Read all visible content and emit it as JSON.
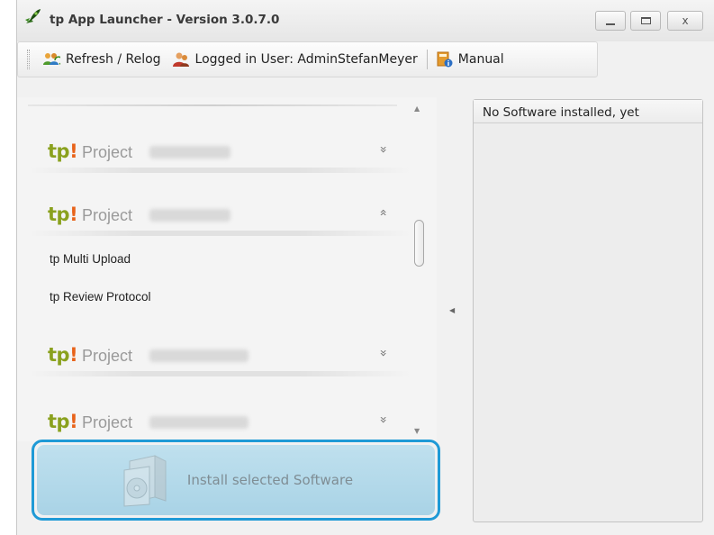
{
  "window": {
    "title": "tp App Launcher - Version 3.0.7.0",
    "controls": {
      "minimize": "minimize",
      "maximize": "maximize",
      "close": "x"
    }
  },
  "toolbar": {
    "refresh_label": "Refresh / Relog",
    "user_label": "Logged in User: AdminStefanMeyer",
    "manual_label": "Manual"
  },
  "projects": {
    "items": [
      {
        "logo_t": "tp",
        "logo_ex": "!",
        "label": "Project",
        "expanded": false,
        "chevron": "»"
      },
      {
        "logo_t": "tp",
        "logo_ex": "!",
        "label": "Project",
        "expanded": true,
        "chevron": "«",
        "children": [
          "tp Multi Upload",
          "tp Review Protocol"
        ]
      },
      {
        "logo_t": "tp",
        "logo_ex": "!",
        "label": "Project",
        "expanded": false,
        "chevron": "»"
      },
      {
        "logo_t": "tp",
        "logo_ex": "!",
        "label": "Project",
        "expanded": false,
        "chevron": "»"
      }
    ]
  },
  "right_panel": {
    "header": "No Software installed, yet"
  },
  "install_button": {
    "label": "Install selected Software"
  },
  "colors": {
    "accent_border": "#1f9ad6",
    "install_bg": "#b5daeb",
    "logo_green": "#8aa11e",
    "logo_orange": "#e8631a"
  },
  "icons": {
    "app": "rocket-icon",
    "refresh": "users-refresh-icon",
    "user": "user-icon",
    "manual": "book-info-icon",
    "install": "software-box-icon"
  }
}
